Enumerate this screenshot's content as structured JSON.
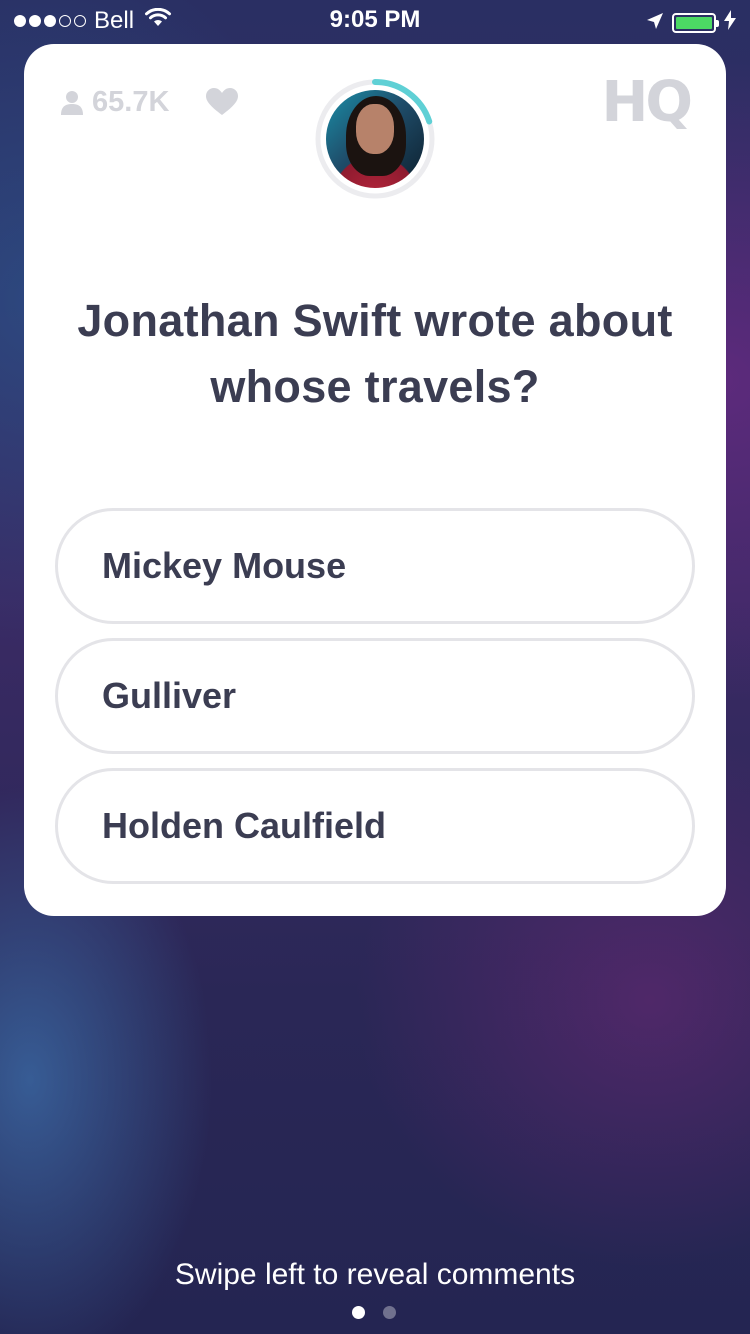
{
  "status_bar": {
    "carrier": "Bell",
    "time": "9:05 PM",
    "signal_bars_filled": 3,
    "signal_bars_total": 5,
    "battery_level": 1.0,
    "battery_color": "#4cd964"
  },
  "card": {
    "viewer_count": "65.7K",
    "logo_text": "HQ",
    "host_timer_progress": 0.2,
    "timer_color": "#5fd0d5",
    "question": "Jonathan Swift wrote about whose travels?",
    "answers": [
      {
        "label": "Mickey Mouse"
      },
      {
        "label": "Gulliver"
      },
      {
        "label": "Holden Caulfield"
      }
    ]
  },
  "footer": {
    "swipe_hint": "Swipe left to reveal comments",
    "page_count": 2,
    "active_page": 0
  },
  "colors": {
    "text_dark": "#3b3d52",
    "muted": "#d3d4da",
    "answer_border": "#e4e4e8"
  }
}
